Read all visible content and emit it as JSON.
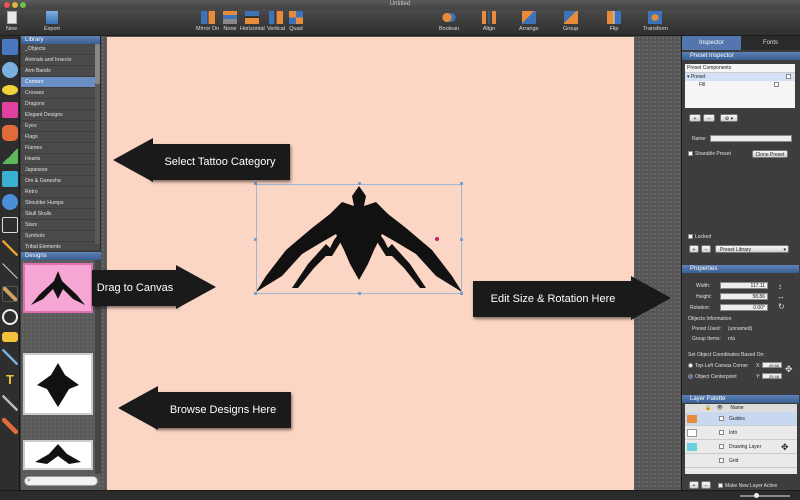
{
  "window": {
    "title": "Untitled"
  },
  "toolbar": {
    "new": "New",
    "export": "Export",
    "mirror_on": "Mirror On",
    "none": "None",
    "horizontal": "Horizontal",
    "vertical": "Vertical",
    "quad": "Quad",
    "boolean": "Boolean",
    "align": "Align",
    "arrange": "Arrange",
    "group": "Group",
    "flip": "Flip",
    "transform": "Transform"
  },
  "library": {
    "header": "Library",
    "items": [
      "_Objects",
      "Animals and Insects",
      "Arm Bands",
      "Corners",
      "Crosses",
      "Dragons",
      "Elegant Designs",
      "Eyes",
      "Flags",
      "Flames",
      "Hearts",
      "Japanese",
      "Om & Ganesha",
      "Retro",
      "Shoulder Humps",
      "Skull Skulls",
      "Stars",
      "Symbols",
      "Tribal Elements"
    ],
    "selected_index": 3
  },
  "designs": {
    "header": "Designs"
  },
  "callouts": {
    "select_category": "Select Tattoo Category",
    "drag_canvas": "Drag to Canvas",
    "browse_designs": "Browse Designs Here",
    "edit_size": "Edit Size & Rotation Here"
  },
  "inspector": {
    "tab_inspector": "Inspector",
    "tab_fonts": "Fonts",
    "preset_header": "Preset Inspector",
    "components_header": "Preset Components",
    "component_preset": "Preset",
    "component_fill": "Fill",
    "name_label": "Name:",
    "sharable_label": "Sharable Preset",
    "clone_button": "Clone Preset",
    "locked_label": "Locked",
    "preset_library": "Preset Library",
    "plus": "+",
    "minus": "–",
    "gear": "⚙ ▾"
  },
  "properties": {
    "header": "Properties",
    "width_label": "Width:",
    "width_value": "117.11",
    "height_label": "Height:",
    "height_value": "58.86",
    "rotation_label": "Rotation:",
    "rotation_value": "0.00°",
    "objects_info": "Objects Information",
    "preset_used_label": "Preset Used:",
    "preset_used_value": "(unnamed)",
    "group_items_label": "Group Items:",
    "group_items_value": "n/a",
    "coords_label": "Set Object Coordinates Based On:",
    "top_left": "Top-Left Canvas Corner",
    "centerpoint": "Object Centerpoint",
    "x_label": "X:",
    "x_value": "49.88",
    "y_label": "Y:",
    "y_value": "25.48"
  },
  "layers": {
    "header": "Layer Palette",
    "name_col": "Name",
    "rows": [
      "Guides",
      "Info",
      "Drawing Layer",
      "Grid"
    ],
    "make_active": "Make New Layer Active"
  },
  "colors": {
    "accent": "#5276ad",
    "canvas": "#fcd6c4",
    "tattoo": "#111111"
  }
}
